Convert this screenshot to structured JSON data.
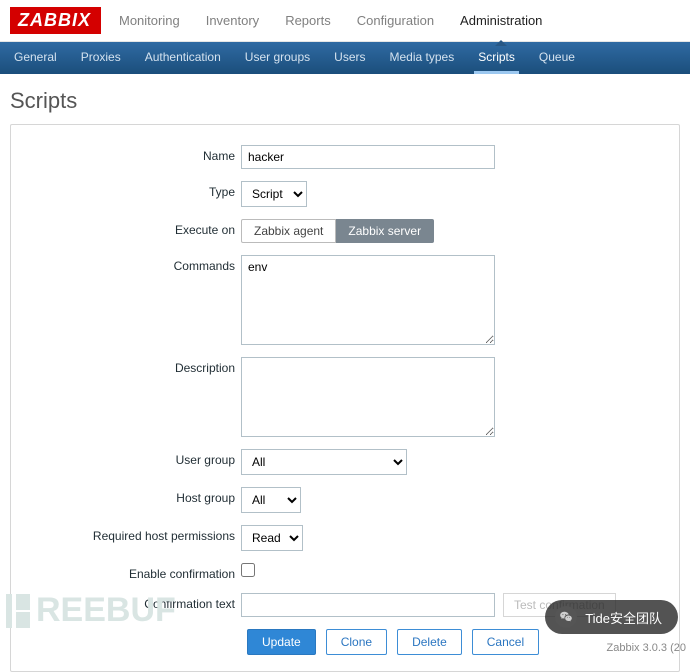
{
  "logo": "ZABBIX",
  "topnav": {
    "items": [
      {
        "label": "Monitoring"
      },
      {
        "label": "Inventory"
      },
      {
        "label": "Reports"
      },
      {
        "label": "Configuration"
      },
      {
        "label": "Administration",
        "active": true
      }
    ]
  },
  "subnav": {
    "items": [
      {
        "label": "General"
      },
      {
        "label": "Proxies"
      },
      {
        "label": "Authentication"
      },
      {
        "label": "User groups"
      },
      {
        "label": "Users"
      },
      {
        "label": "Media types"
      },
      {
        "label": "Scripts",
        "active": true
      },
      {
        "label": "Queue"
      }
    ]
  },
  "page": {
    "title": "Scripts"
  },
  "form": {
    "name": {
      "label": "Name",
      "value": "hacker"
    },
    "type": {
      "label": "Type",
      "value": "Script"
    },
    "execute_on": {
      "label": "Execute on",
      "options": [
        "Zabbix agent",
        "Zabbix server"
      ],
      "selected": "Zabbix server"
    },
    "commands": {
      "label": "Commands",
      "value": "env"
    },
    "description": {
      "label": "Description",
      "value": ""
    },
    "user_group": {
      "label": "User group",
      "value": "All"
    },
    "host_group": {
      "label": "Host group",
      "value": "All"
    },
    "permissions": {
      "label": "Required host permissions",
      "value": "Read"
    },
    "enable_confirmation": {
      "label": "Enable confirmation",
      "checked": false
    },
    "confirmation_text": {
      "label": "Confirmation text",
      "value": "",
      "test_label": "Test confirmation"
    },
    "buttons": {
      "update": "Update",
      "clone": "Clone",
      "delete": "Delete",
      "cancel": "Cancel"
    }
  },
  "watermark": "REEBUF",
  "wechat": {
    "label": "Tide安全团队"
  },
  "footer": {
    "version": "Zabbix 3.0.3 (20"
  }
}
